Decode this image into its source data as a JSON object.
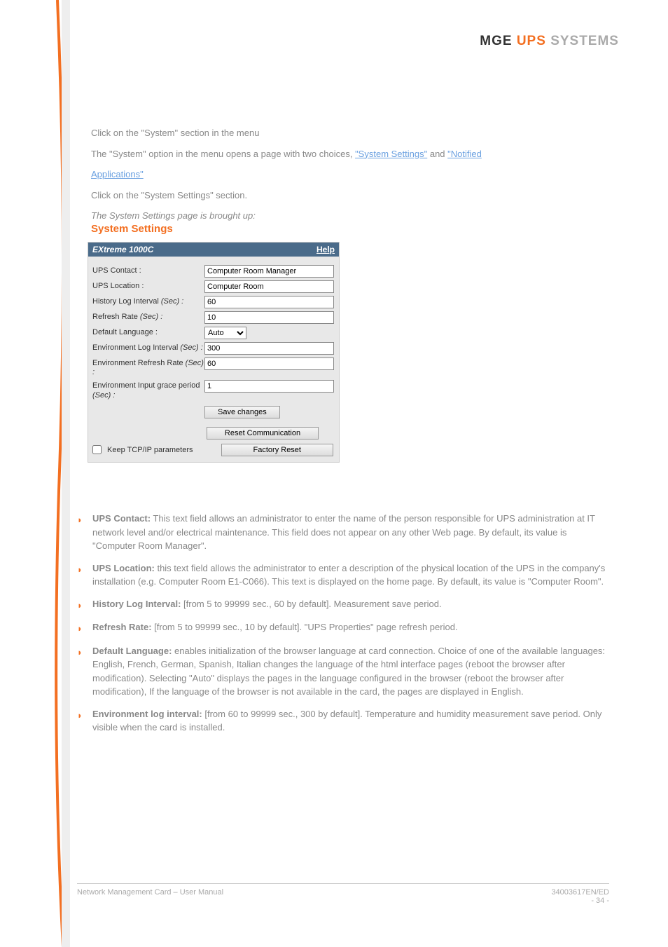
{
  "brand": {
    "mge": "MGE",
    "ups": "UPS",
    "systems": "SYSTEMS"
  },
  "intro": {
    "p1": "Click on the \"System\" section in the menu",
    "p2_prefix": "The \"System\" option in the menu opens a page with two choices, ",
    "p2_link1": "\"System Settings\"",
    "p2_mid": " and ",
    "p2_link2": "\"Notified",
    "p3": "Applications\"",
    "p4": "Click on the \"System Settings\" section.",
    "p5": "The System Settings page is brought up:"
  },
  "section_title": "System Settings",
  "panel": {
    "title": "EXtreme 1000C",
    "help": "Help",
    "rows": {
      "ups_contact_label": "UPS Contact :",
      "ups_contact_value": "Computer Room Manager",
      "ups_location_label": "UPS Location :",
      "ups_location_value": "Computer Room",
      "history_label": "History Log Interval ",
      "history_sec": "(Sec) :",
      "history_value": "60",
      "refresh_label": "Refresh Rate ",
      "refresh_sec": "(Sec) :",
      "refresh_value": "10",
      "lang_label": "Default Language :",
      "lang_value": "Auto",
      "env_log_label": "Environment Log Interval ",
      "env_log_sec": "(Sec) :",
      "env_log_value": "300",
      "env_refresh_label": "Environment Refresh Rate ",
      "env_refresh_sec": "(Sec) :",
      "env_refresh_value": "60",
      "env_input_label": "Environment Input grace period ",
      "env_input_sec": "(Sec) :",
      "env_input_value": "1"
    },
    "buttons": {
      "save": "Save changes",
      "reset_comm": "Reset Communication",
      "factory": "Factory Reset"
    },
    "keep_tcpip": "Keep TCP/IP parameters"
  },
  "bullets": [
    {
      "bold": "UPS Contact:",
      "rest": " This text field allows an administrator to enter the name of the person responsible for UPS administration at IT network level and/or electrical maintenance. This field does not appear on any other Web page. By default, its value is \"Computer Room Manager\"."
    },
    {
      "bold": "UPS Location:",
      "rest": " this text field allows the administrator to enter a description of the physical location of the UPS in the company's installation (e.g. Computer Room E1-C066). This text is displayed on the home page. By default, its value is \"Computer Room\"."
    },
    {
      "bold": "History Log Interval:",
      "rest": " [from 5 to 99999 sec., 60 by default]. Measurement save period."
    },
    {
      "bold": "Refresh Rate:",
      "rest": " [from 5 to 99999 sec., 10 by default]. \"UPS Properties\" page refresh period."
    },
    {
      "bold": "Default Language:",
      "rest": " enables initialization of the browser language at card connection. Choice of one of the available languages: English, French, German, Spanish, Italian changes the language of the html interface pages (reboot the browser after modification). Selecting \"Auto\" displays the pages in the language configured in the browser (reboot the browser after modification), If the language of the browser is not available in the card, the pages are displayed in English."
    },
    {
      "bold": "Environment log interval:",
      "rest": " [from 60 to 99999 sec., 300 by default]. Temperature and humidity measurement save period. Only visible when the card is installed."
    }
  ],
  "footer": {
    "left": "Network Management Card – User Manual",
    "right_line1": "34003617EN/ED",
    "right_line2": "- 34 -"
  }
}
